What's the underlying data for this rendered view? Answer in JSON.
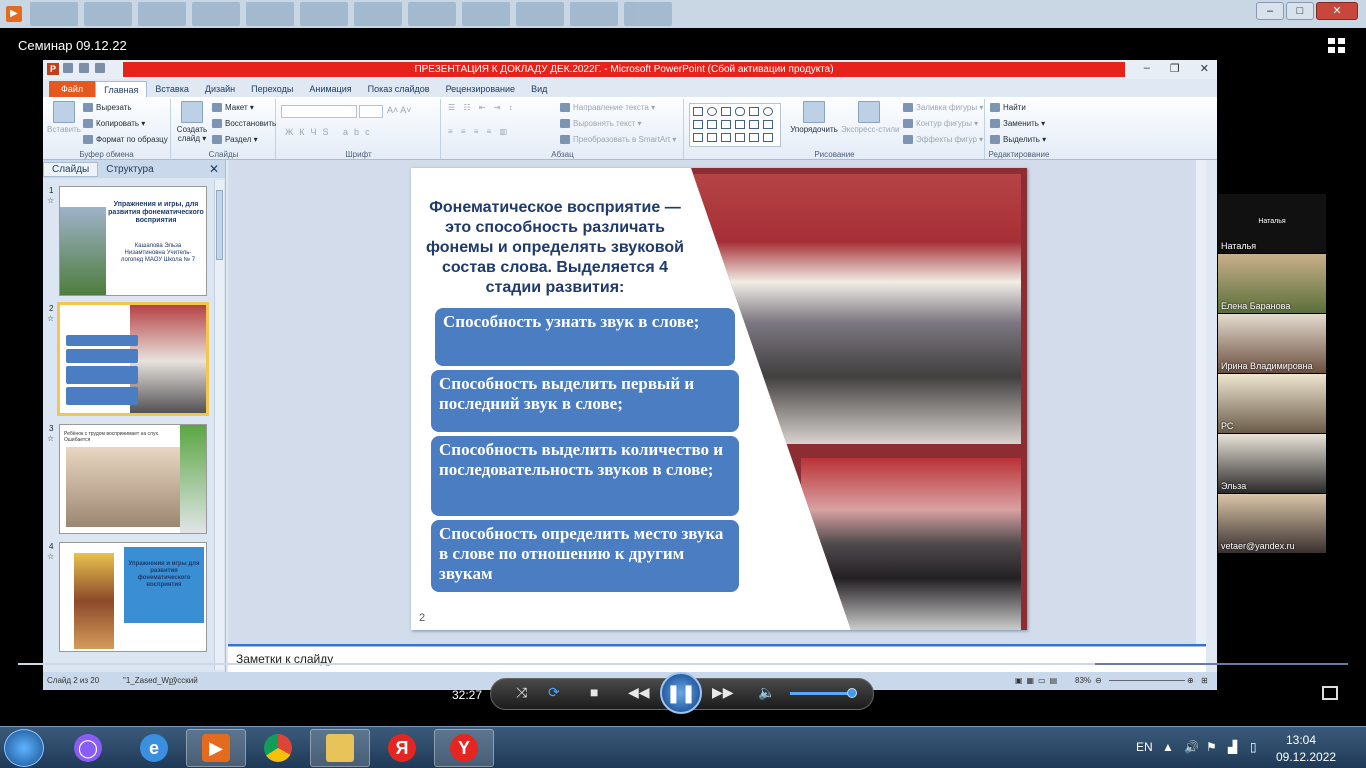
{
  "player": {
    "meeting_title": "Семинар 09.12.22",
    "elapsed_time": "32:27",
    "volume_level": 0.94,
    "progress_fraction": 0.81
  },
  "ppt": {
    "window_title": "ПРЕЗЕНТАЦИЯ К ДОКЛАДУ ДЕК.2022Г. - Microsoft PowerPoint (Сбой активации продукта)",
    "tabs": [
      "Файл",
      "Главная",
      "Вставка",
      "Дизайн",
      "Переходы",
      "Анимация",
      "Показ слайдов",
      "Рецензирование",
      "Вид"
    ],
    "ribbon": {
      "clipboard": {
        "paste": "Вставить",
        "cut": "Вырезать",
        "copy": "Копировать",
        "format_painter": "Формат по образцу",
        "label": "Буфер обмена"
      },
      "slides": {
        "new_slide": "Создать слайд",
        "layout": "Макет",
        "reset": "Восстановить",
        "section": "Раздел",
        "label": "Слайды"
      },
      "font": {
        "label": "Шрифт"
      },
      "paragraph": {
        "text_direction": "Направление текста",
        "align_text": "Выровнять текст",
        "smartart": "Преобразовать в SmartArt",
        "label": "Абзац"
      },
      "drawing": {
        "arrange": "Упорядочить",
        "quick_styles": "Экспресс-стили",
        "shape_fill": "Заливка фигуры",
        "shape_outline": "Контур фигуры",
        "shape_effects": "Эффекты фигур",
        "label": "Рисование"
      },
      "editing": {
        "find": "Найти",
        "replace": "Заменить",
        "select": "Выделить",
        "label": "Редактирование"
      }
    },
    "pane_tabs": {
      "slides": "Слайды",
      "outline": "Структура"
    },
    "thumbs": [
      {
        "num": "1",
        "title": "Упражнения и игры, для развития фонематического восприятия",
        "author": "Кашапова Эльза Низамтиновна Учитель-логопед МАОУ Школа № 7"
      },
      {
        "num": "2"
      },
      {
        "num": "3",
        "caption": "Ребёнок с трудом воспринимает на слух. Ошибается"
      },
      {
        "num": "4",
        "title": "Упражнения и игры для развития фонематического восприятия"
      }
    ],
    "slide": {
      "title": "Фонематическое восприятие — это способность различать фонемы и определять звуковой состав слова. Выделяется 4 стадии развития:",
      "bullets": [
        "Способность узнать звук в слове;",
        "Способность выделить первый и последний звук в слове;",
        "Способность выделить количество и последовательность звуков в слове;",
        "Способность определить место звука в слове по отношению к другим звукам"
      ],
      "number": "2"
    },
    "notes_placeholder": "Заметки к слайду",
    "status": {
      "slide_counter": "Слайд 2 из 20",
      "theme": "\"1_Zased_W_\"",
      "language": "русский",
      "zoom": "83%"
    }
  },
  "participants": [
    {
      "top_label": "Наталья",
      "name": "Наталья",
      "bg": "#111"
    },
    {
      "name": "Елена Баранова",
      "bg": "#8e7a5b"
    },
    {
      "name": "Ирина Владимировна",
      "bg": "#b9a58e"
    },
    {
      "name": "РС",
      "bg": "#cfc2a8"
    },
    {
      "name": "Эльза",
      "bg": "#6a6a5a"
    },
    {
      "name": "vetaer@yandex.ru",
      "bg": "#a58d72"
    }
  ],
  "taskbar": {
    "language": "EN",
    "time": "13:04",
    "date": "09.12.2022"
  },
  "colors": {
    "accent": "#4a7dc2",
    "ppt_red": "#e5231a",
    "title_blue": "#1f3a6b"
  }
}
